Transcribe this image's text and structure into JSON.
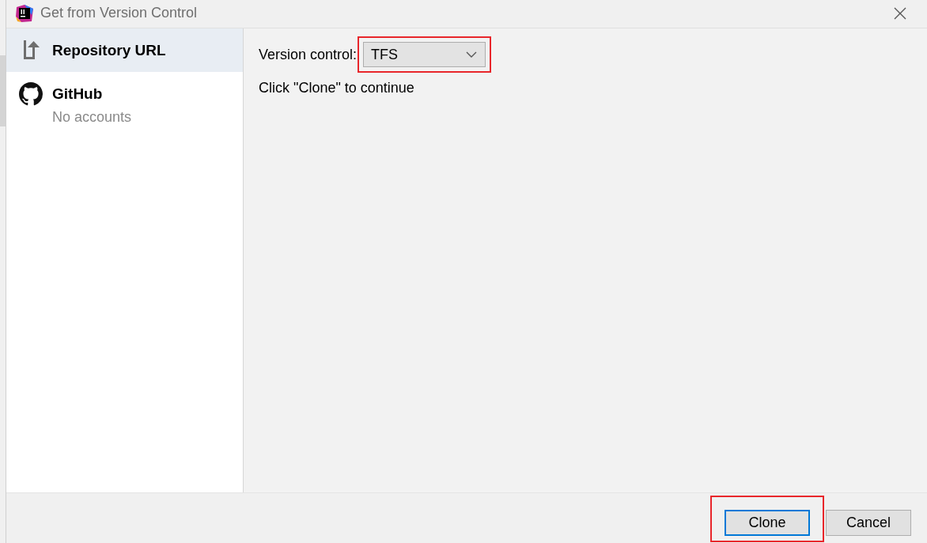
{
  "window": {
    "title": "Get from Version Control"
  },
  "sidebar": {
    "items": [
      {
        "kind": "url",
        "label": "Repository URL",
        "selected": true
      },
      {
        "kind": "github",
        "label": "GitHub",
        "subtitle": "No accounts",
        "selected": false
      }
    ]
  },
  "main": {
    "version_control": {
      "label": "Version control:",
      "value": "TFS",
      "highlighted": true
    },
    "hint": "Click \"Clone\" to continue"
  },
  "buttons": [
    {
      "label": "Clone",
      "default": true,
      "highlighted": true
    },
    {
      "label": "Cancel",
      "default": false,
      "highlighted": false
    }
  ]
}
